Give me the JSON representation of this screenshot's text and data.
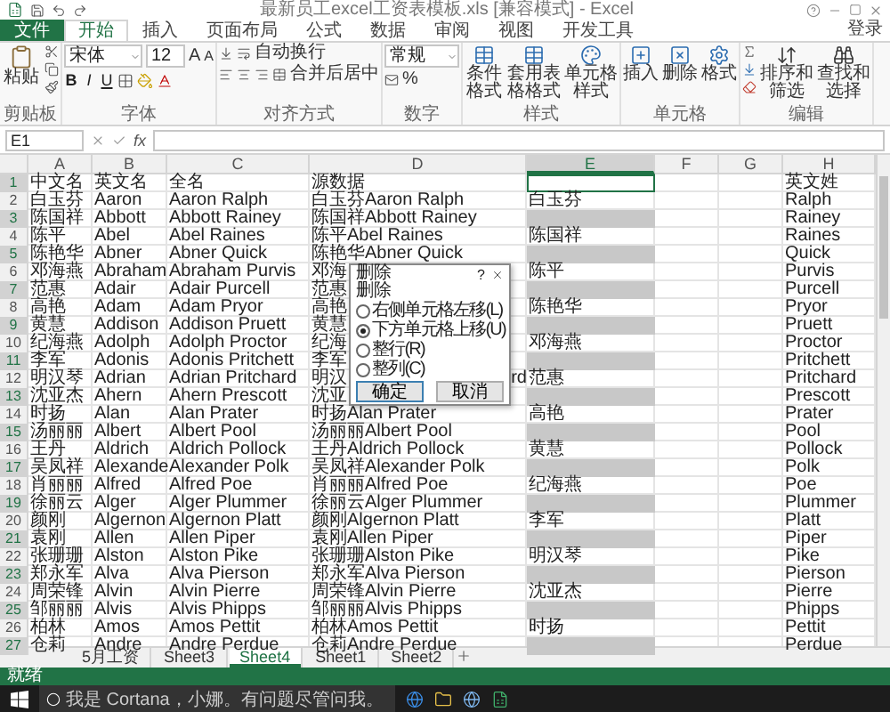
{
  "window": {
    "title": "最新员工excel工资表模板.xls [兼容模式] - Excel"
  },
  "menu_tabs": [
    {
      "label": "文件",
      "kind": "file",
      "selected": false
    },
    {
      "label": "开始",
      "kind": "tab",
      "selected": true
    },
    {
      "label": "插入",
      "kind": "tab",
      "selected": false
    },
    {
      "label": "页面布局",
      "kind": "tab",
      "selected": false
    },
    {
      "label": "公式",
      "kind": "tab",
      "selected": false
    },
    {
      "label": "数据",
      "kind": "tab",
      "selected": false
    },
    {
      "label": "审阅",
      "kind": "tab",
      "selected": false
    },
    {
      "label": "视图",
      "kind": "tab",
      "selected": false
    },
    {
      "label": "开发工具",
      "kind": "tab",
      "selected": false
    }
  ],
  "account": "登录",
  "ribbon": {
    "clipboard": {
      "label": "剪贴板",
      "paste": "粘贴"
    },
    "font": {
      "label": "字体",
      "font_name": "宋体",
      "font_size": "12",
      "grow": "A",
      "shrink": "A",
      "styles": [
        "B",
        "I",
        "U"
      ]
    },
    "alignment": {
      "label": "对齐方式",
      "wrap": "自动换行",
      "merge": "合并后居中"
    },
    "number": {
      "label": "数字",
      "format": "常规",
      "percent": "%"
    },
    "styles": {
      "label": "样式",
      "buttons": [
        "条件格式",
        "套用表格格式",
        "单元格样式"
      ]
    },
    "cells": {
      "label": "单元格",
      "buttons": [
        "插入",
        "删除",
        "格式"
      ]
    },
    "editing": {
      "label": "编辑",
      "buttons": [
        "排序和筛选",
        "查找和选择"
      ]
    }
  },
  "formula_bar": {
    "name_box": "E1",
    "fx": "fx"
  },
  "columns": [
    {
      "label": "A",
      "selected": false
    },
    {
      "label": "B",
      "selected": false
    },
    {
      "label": "C",
      "selected": false
    },
    {
      "label": "D",
      "selected": false
    },
    {
      "label": "E",
      "selected": true
    },
    {
      "label": "F",
      "selected": false
    },
    {
      "label": "G",
      "selected": false
    },
    {
      "label": "H",
      "selected": false
    }
  ],
  "rows": [
    {
      "n": "1",
      "selected": true,
      "active": true,
      "a": "中文名",
      "b": "英文名",
      "c": "全名",
      "d": "源数据",
      "h": "英文姓"
    },
    {
      "n": "2",
      "selected": false,
      "active": false,
      "a": "白玉芬",
      "b": "Aaron",
      "c": "Aaron Ralph",
      "d": "白玉芬Aaron Ralph",
      "e": "白玉芬",
      "h": "Ralph"
    },
    {
      "n": "3",
      "selected": true,
      "active": false,
      "a": "陈国祥",
      "b": "Abbott",
      "c": "Abbott Rainey",
      "d": "陈国祥Abbott Rainey",
      "h": "Rainey"
    },
    {
      "n": "4",
      "selected": false,
      "active": false,
      "a": "陈平",
      "b": "Abel",
      "c": "Abel Raines",
      "d": "陈平Abel Raines",
      "e": "陈国祥",
      "h": "Raines"
    },
    {
      "n": "5",
      "selected": true,
      "active": false,
      "a": "陈艳华",
      "b": "Abner",
      "c": "Abner Quick",
      "d": "陈艳华Abner Quick",
      "h": "Quick"
    },
    {
      "n": "6",
      "selected": false,
      "active": false,
      "a": "邓海燕",
      "b": "Abraham",
      "c": "Abraham Purvis",
      "d": "邓海",
      "e": "陈平",
      "h": "Purvis"
    },
    {
      "n": "7",
      "selected": true,
      "active": false,
      "a": "范惠",
      "b": "Adair",
      "c": "Adair Purcell",
      "d": "范惠",
      "h": "Purcell"
    },
    {
      "n": "8",
      "selected": false,
      "active": false,
      "a": "高艳",
      "b": "Adam",
      "c": "Adam Pryor",
      "d": "高艳",
      "e": "陈艳华",
      "h": "Pryor"
    },
    {
      "n": "9",
      "selected": true,
      "active": false,
      "a": "黄慧",
      "b": "Addison",
      "c": "Addison Pruett",
      "d": "黄慧",
      "h": "Pruett"
    },
    {
      "n": "10",
      "selected": false,
      "active": false,
      "a": "纪海燕",
      "b": "Adolph",
      "c": "Adolph Proctor",
      "d": "纪海",
      "e": "邓海燕",
      "h": "Proctor"
    },
    {
      "n": "11",
      "selected": true,
      "active": false,
      "a": "李军",
      "b": "Adonis",
      "c": "Adonis Pritchett",
      "d": "李军",
      "h": "Pritchett"
    },
    {
      "n": "12",
      "selected": false,
      "active": false,
      "a": "明汉琴",
      "b": "Adrian",
      "c": "Adrian Pritchard",
      "d": "明汉",
      "d_tail": "rd",
      "e": "范惠",
      "h": "Pritchard"
    },
    {
      "n": "13",
      "selected": true,
      "active": false,
      "a": "沈亚杰",
      "b": "Ahern",
      "c": "Ahern Prescott",
      "d": "沈亚",
      "h": "Prescott"
    },
    {
      "n": "14",
      "selected": false,
      "active": false,
      "a": "时扬",
      "b": "Alan",
      "c": "Alan Prater",
      "d": "时扬Alan Prater",
      "e": "高艳",
      "h": "Prater"
    },
    {
      "n": "15",
      "selected": true,
      "active": false,
      "a": "汤丽丽",
      "b": "Albert",
      "c": "Albert Pool",
      "d": "汤丽丽Albert Pool",
      "h": "Pool"
    },
    {
      "n": "16",
      "selected": false,
      "active": false,
      "a": "王丹",
      "b": "Aldrich",
      "c": "Aldrich Pollock",
      "d": "王丹Aldrich Pollock",
      "e": "黄慧",
      "h": "Pollock"
    },
    {
      "n": "17",
      "selected": true,
      "active": false,
      "a": "吴凤祥",
      "b": "Alexande",
      "c": "Alexander Polk",
      "d": "吴凤祥Alexander Polk",
      "h": "Polk"
    },
    {
      "n": "18",
      "selected": false,
      "active": false,
      "a": "肖丽丽",
      "b": "Alfred",
      "c": "Alfred Poe",
      "d": "肖丽丽Alfred Poe",
      "e": "纪海燕",
      "h": "Poe"
    },
    {
      "n": "19",
      "selected": true,
      "active": false,
      "a": "徐丽云",
      "b": "Alger",
      "c": "Alger Plummer",
      "d": "徐丽云Alger Plummer",
      "h": "Plummer"
    },
    {
      "n": "20",
      "selected": false,
      "active": false,
      "a": "颜刚",
      "b": "Algernon",
      "c": "Algernon Platt",
      "d": "颜刚Algernon Platt",
      "e": "李军",
      "h": "Platt"
    },
    {
      "n": "21",
      "selected": true,
      "active": false,
      "a": "袁刚",
      "b": "Allen",
      "c": "Allen Piper",
      "d": "袁刚Allen Piper",
      "h": "Piper"
    },
    {
      "n": "22",
      "selected": false,
      "active": false,
      "a": "张珊珊",
      "b": "Alston",
      "c": "Alston Pike",
      "d": "张珊珊Alston Pike",
      "e": "明汉琴",
      "h": "Pike"
    },
    {
      "n": "23",
      "selected": true,
      "active": false,
      "a": "郑永军",
      "b": "Alva",
      "c": "Alva Pierson",
      "d": "郑永军Alva Pierson",
      "h": "Pierson"
    },
    {
      "n": "24",
      "selected": false,
      "active": false,
      "a": "周荣锋",
      "b": "Alvin",
      "c": "Alvin Pierre",
      "d": "周荣锋Alvin Pierre",
      "e": "沈亚杰",
      "h": "Pierre"
    },
    {
      "n": "25",
      "selected": true,
      "active": false,
      "a": "邹丽丽",
      "b": "Alvis",
      "c": "Alvis Phipps",
      "d": "邹丽丽Alvis Phipps",
      "h": "Phipps"
    },
    {
      "n": "26",
      "selected": false,
      "active": false,
      "a": "柏林",
      "b": "Amos",
      "c": "Amos Pettit",
      "d": "柏林Amos Pettit",
      "e": "时扬",
      "h": "Pettit"
    },
    {
      "n": "27",
      "selected": true,
      "active": false,
      "a": "仓莉",
      "b": "Andre",
      "c": "Andre Perdue",
      "d": "仓莉Andre Perdue",
      "h": "Perdue"
    }
  ],
  "dialog": {
    "title": "删除",
    "help": "?",
    "section": "删除",
    "options": [
      {
        "label": "右侧单元格左移(L)",
        "selected": false
      },
      {
        "label": "下方单元格上移(U)",
        "selected": true
      },
      {
        "label": "整行(R)",
        "selected": false
      },
      {
        "label": "整列(C)",
        "selected": false
      }
    ],
    "buttons": [
      {
        "label": "确定",
        "default": true
      },
      {
        "label": "取消",
        "default": false
      }
    ]
  },
  "sheet_tabs": [
    {
      "label": "5月工资",
      "selected": false
    },
    {
      "label": "Sheet3",
      "selected": false
    },
    {
      "label": "Sheet4",
      "selected": true
    },
    {
      "label": "Sheet1",
      "selected": false
    },
    {
      "label": "Sheet2",
      "selected": false
    }
  ],
  "status": "就绪",
  "taskbar": {
    "search": "我是 Cortana，小娜。有问题尽管问我。"
  }
}
